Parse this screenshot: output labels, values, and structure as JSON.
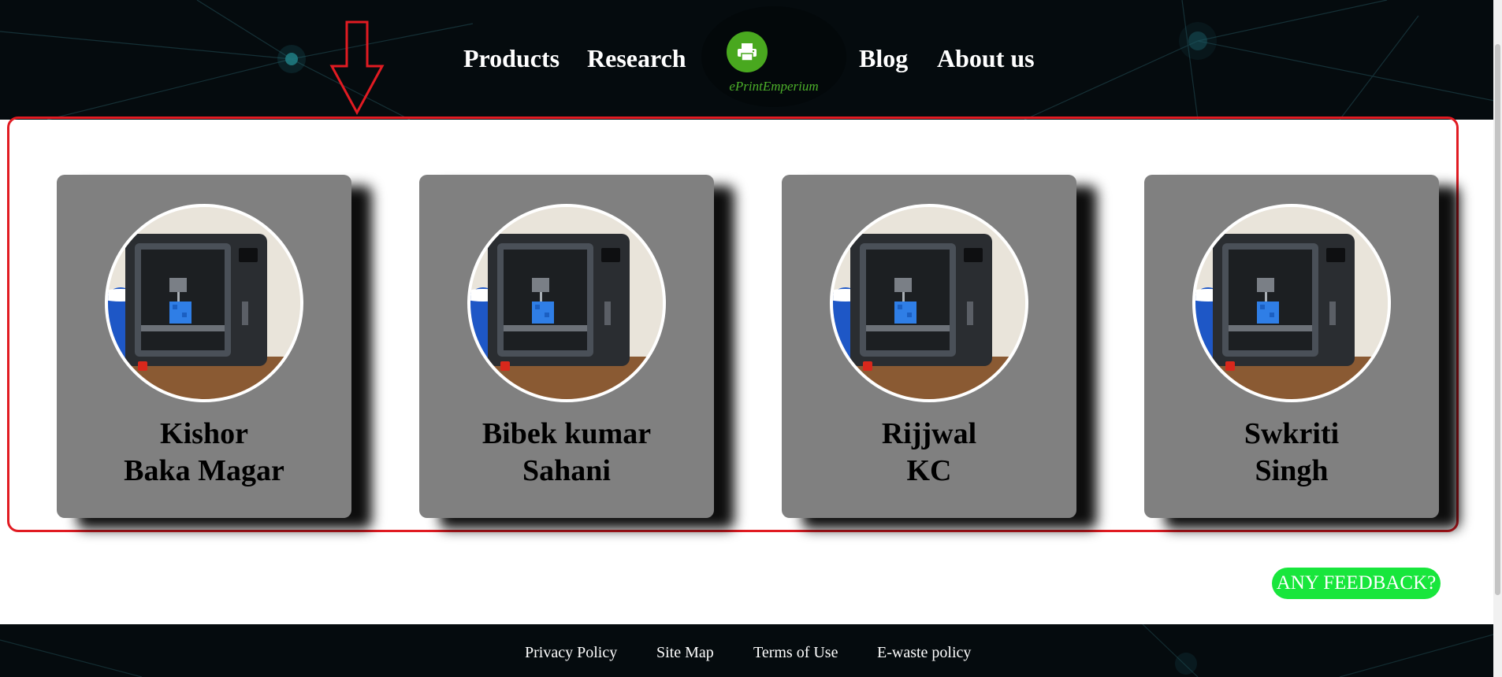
{
  "nav": {
    "products": "Products",
    "research": "Research",
    "blog": "Blog",
    "about": "About us"
  },
  "logo": {
    "name": "ePrintEmperium",
    "icon": "printer-icon"
  },
  "team": [
    {
      "line1": "Kishor",
      "line2": "Baka Magar"
    },
    {
      "line1": "Bibek kumar",
      "line2": "Sahani"
    },
    {
      "line1": "Rijjwal",
      "line2": "KC"
    },
    {
      "line1": "Swkriti",
      "line2": "Singh"
    }
  ],
  "feedback": {
    "label": "ANY FEEDBACK?"
  },
  "footer": {
    "privacy": "Privacy Policy",
    "sitemap": "Site Map",
    "terms": "Terms of Use",
    "ewaste": "E-waste policy"
  },
  "colors": {
    "header_bg": "#050b0e",
    "logo_green": "#49a81f",
    "annotation_red": "#e11b22",
    "card_gray": "#808080",
    "feedback_green": "#18e63c"
  }
}
